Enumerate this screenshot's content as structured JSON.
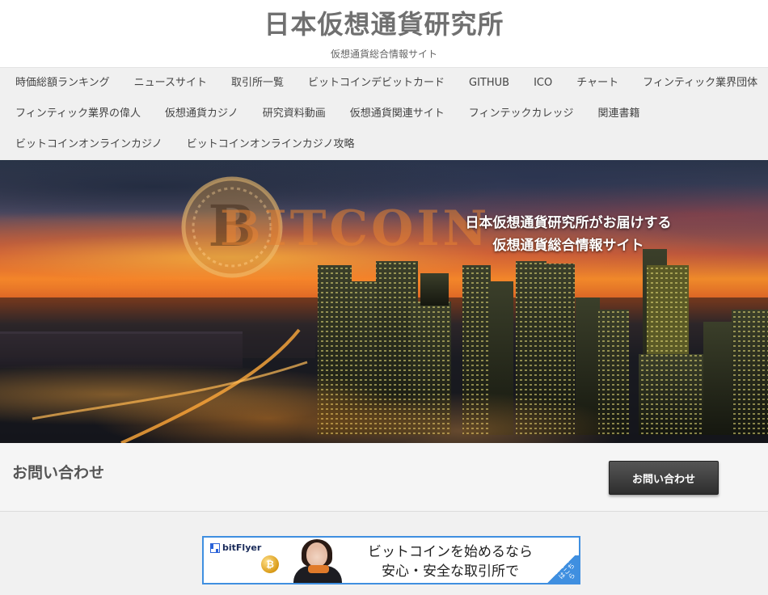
{
  "site": {
    "title": "日本仮想通貨研究所",
    "tagline": "仮想通貨総合情報サイト"
  },
  "nav": {
    "rows": [
      [
        "時価総額ランキング",
        "ニュースサイト",
        "取引所一覧",
        "ビットコインデビットカード",
        "GITHUB",
        "ICO",
        "チャート",
        "フィンティック業界団体"
      ],
      [
        "フィンティック業界の偉人",
        "仮想通貨カジノ",
        "研究資料動画",
        "仮想通貨関連サイト",
        "フィンテックカレッジ",
        "関連書籍"
      ],
      [
        "ビットコインオンラインカジノ",
        "ビットコインオンラインカジノ攻略"
      ]
    ]
  },
  "hero": {
    "coin_text": "BITCOIN",
    "line1": "日本仮想通貨研究所がお届けする",
    "line2": "仮想通貨総合情報サイト"
  },
  "contact": {
    "heading": "お問い合わせ",
    "button_label": "お問い合わせ"
  },
  "banner": {
    "brand": "bitFlyer",
    "coin_symbol": "₿",
    "line1": "ビットコインを始めるなら",
    "line2": "安心・安全な取引所で",
    "corner_label": "詳しくはこちら",
    "accent_color": "#3f8fe0"
  }
}
